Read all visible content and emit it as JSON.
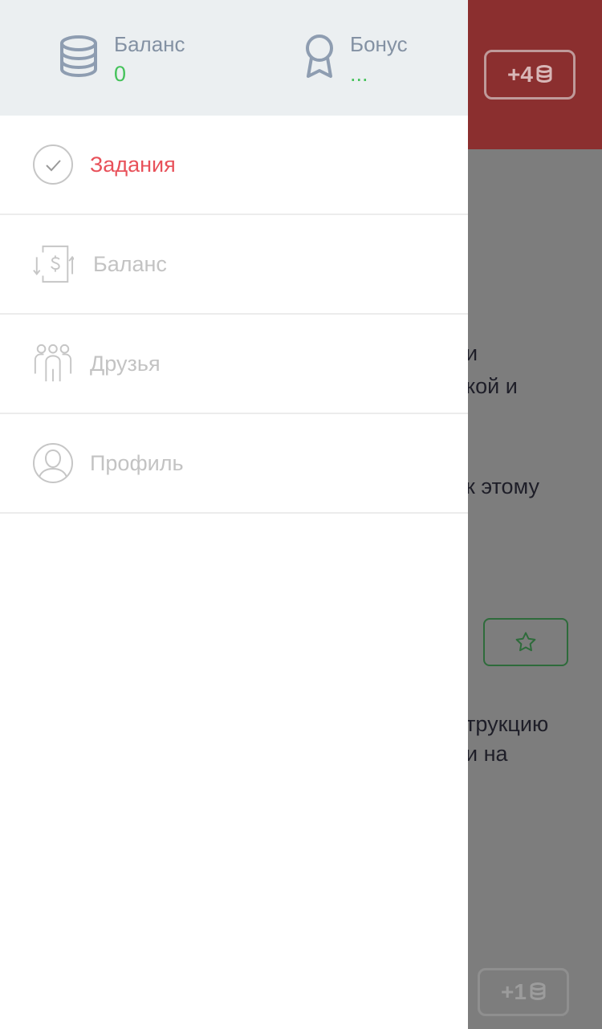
{
  "background": {
    "header_reward": "+4",
    "bottom_reward": "+1",
    "text_fragments": [
      "и",
      "кой и",
      "к этому",
      "трукцию",
      "и на"
    ]
  },
  "drawer": {
    "stats": {
      "balance": {
        "label": "Баланс",
        "value": "0",
        "icon": "coins-icon"
      },
      "bonus": {
        "label": "Бонус",
        "value": "...",
        "icon": "award-icon"
      }
    },
    "menu": [
      {
        "label": "Задания",
        "icon": "check-circle-icon",
        "active": true
      },
      {
        "label": "Баланс",
        "icon": "money-transfer-icon",
        "active": false
      },
      {
        "label": "Друзья",
        "icon": "friends-icon",
        "active": false
      },
      {
        "label": "Профиль",
        "icon": "profile-icon",
        "active": false
      }
    ]
  },
  "colors": {
    "accent_active": "#e8515a",
    "value_green": "#44c25a",
    "label_gray": "#8391a3",
    "inactive_gray": "#c3c3c3"
  }
}
